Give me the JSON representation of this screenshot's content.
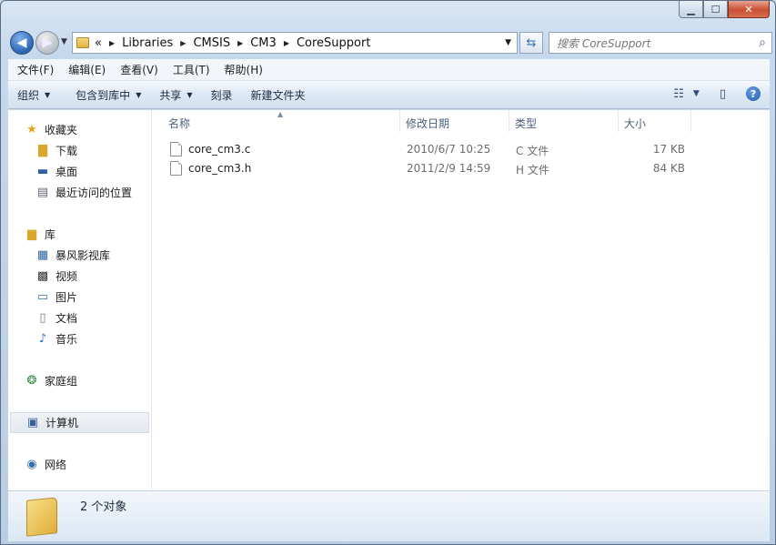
{
  "window": {
    "controls": {
      "minimize": "▁",
      "maximize": "☐",
      "close": "✕"
    }
  },
  "address": {
    "overflow": "«",
    "crumbs": [
      "Libraries",
      "CMSIS",
      "CM3",
      "CoreSupport"
    ]
  },
  "search": {
    "placeholder": "搜索 CoreSupport"
  },
  "menu": [
    "文件(F)",
    "编辑(E)",
    "查看(V)",
    "工具(T)",
    "帮助(H)"
  ],
  "toolbar": {
    "organize": "组织",
    "include_in_library": "包含到库中",
    "share": "共享",
    "burn": "刻录",
    "new_folder": "新建文件夹"
  },
  "sidebar": {
    "favorites": {
      "label": "收藏夹",
      "items": [
        "下载",
        "桌面",
        "最近访问的位置"
      ]
    },
    "libraries": {
      "label": "库",
      "items": [
        "暴风影视库",
        "视频",
        "图片",
        "文档",
        "音乐"
      ]
    },
    "homegroup": "家庭组",
    "computer": "计算机",
    "network": "网络"
  },
  "columns": {
    "name": "名称",
    "date": "修改日期",
    "type": "类型",
    "size": "大小"
  },
  "files": [
    {
      "name": "core_cm3.c",
      "date": "2010/6/7 10:25",
      "type": "C 文件",
      "size": "17 KB"
    },
    {
      "name": "core_cm3.h",
      "date": "2011/2/9 14:59",
      "type": "H 文件",
      "size": "84 KB"
    }
  ],
  "status": {
    "count": "2 个对象"
  }
}
